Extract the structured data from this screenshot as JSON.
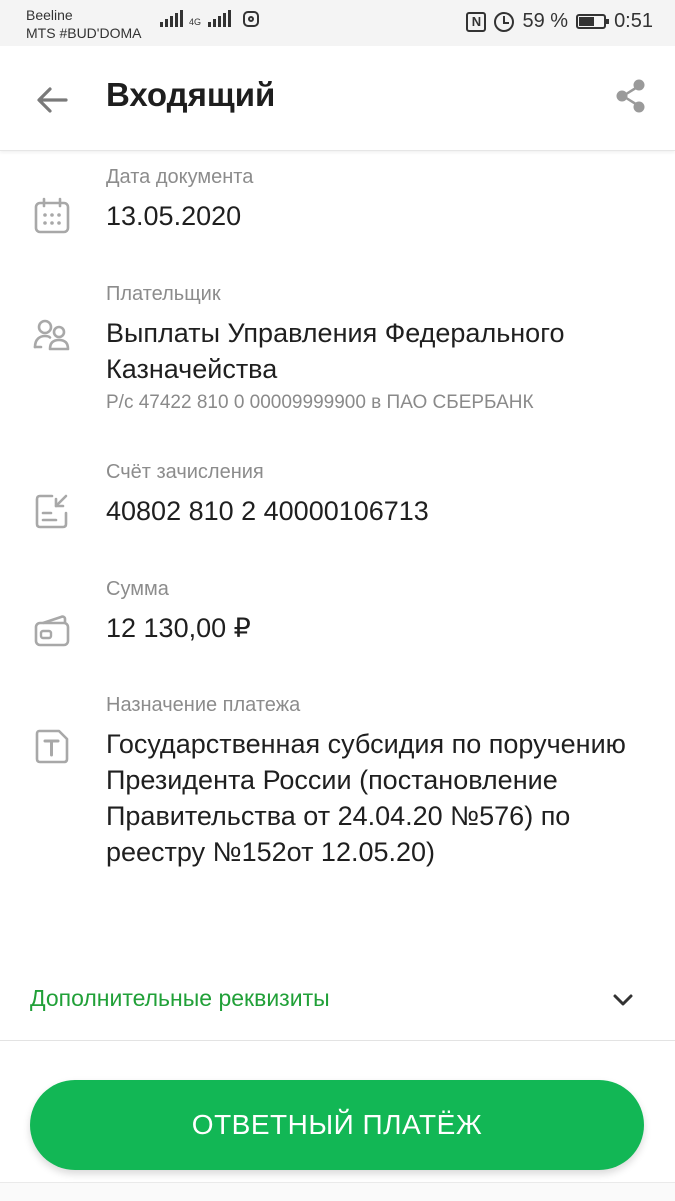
{
  "status_bar": {
    "carrier1": "Beeline",
    "carrier2": "MTS #BUD'DOMA",
    "network": "4G",
    "battery": "59 %",
    "time": "0:51"
  },
  "header": {
    "title": "Входящий"
  },
  "fields": {
    "date": {
      "label": "Дата документа",
      "value": "13.05.2020"
    },
    "payer": {
      "label": "Плательщик",
      "value": "Выплаты Управления Федерального Казначейства",
      "account": "Р/с 47422 810 0 00009999900 в ПАО СБЕРБАНК"
    },
    "account": {
      "label": "Счёт зачисления",
      "value": "40802 810 2 40000106713"
    },
    "amount": {
      "label": "Сумма",
      "value": "12 130,00 ₽"
    },
    "purpose": {
      "label": "Назначение платежа",
      "value": "Государственная субсидия по поручению Президента России (постановление Правительства от 24.04.20 №576) по реестру №152от 12.05.20)"
    }
  },
  "extra_details": {
    "label": "Дополнительные реквизиты"
  },
  "action_button": {
    "label": "ОТВЕТНЫЙ ПЛАТЁЖ"
  },
  "colors": {
    "accent_green": "#21a038",
    "button_green": "#12b755"
  }
}
